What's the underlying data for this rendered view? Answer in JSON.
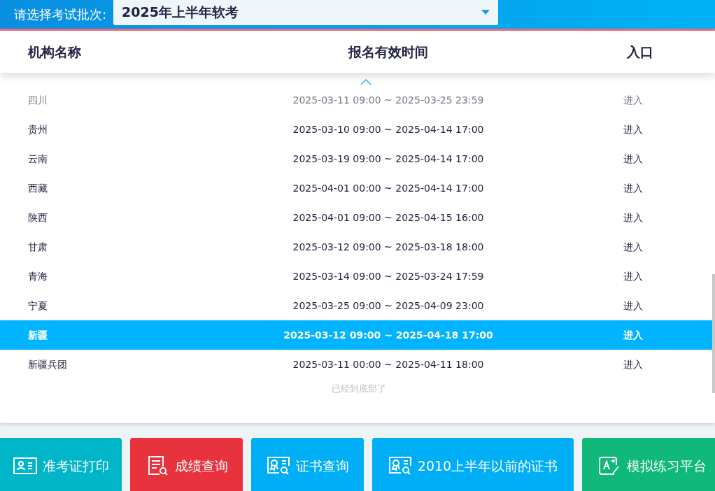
{
  "batch_select": {
    "label": "请选择考试批次:",
    "value": "2025年上半年软考"
  },
  "table": {
    "columns": [
      "机构名称",
      "报名有效时间",
      "入口"
    ],
    "rows": [
      {
        "name": "四川",
        "time": "2025-03-11 09:00 ~ 2025-03-25 23:59",
        "entry": "进入",
        "selected": false
      },
      {
        "name": "贵州",
        "time": "2025-03-10 09:00 ~ 2025-04-14 17:00",
        "entry": "进入",
        "selected": false
      },
      {
        "name": "云南",
        "time": "2025-03-19 09:00 ~ 2025-04-14 17:00",
        "entry": "进入",
        "selected": false
      },
      {
        "name": "西藏",
        "time": "2025-04-01 00:00 ~ 2025-04-14 17:00",
        "entry": "进入",
        "selected": false
      },
      {
        "name": "陕西",
        "time": "2025-04-01 09:00 ~ 2025-04-15 16:00",
        "entry": "进入",
        "selected": false
      },
      {
        "name": "甘肃",
        "time": "2025-03-12 09:00 ~ 2025-03-18 18:00",
        "entry": "进入",
        "selected": false
      },
      {
        "name": "青海",
        "time": "2025-03-14 09:00 ~ 2025-03-24 17:59",
        "entry": "进入",
        "selected": false
      },
      {
        "name": "宁夏",
        "time": "2025-03-25 09:00 ~ 2025-04-09 23:00",
        "entry": "进入",
        "selected": false
      },
      {
        "name": "新疆",
        "time": "2025-03-12 09:00 ~ 2025-04-18 17:00",
        "entry": "进入",
        "selected": true
      },
      {
        "name": "新疆兵团",
        "time": "2025-03-11 00:00 ~ 2025-04-11 18:00",
        "entry": "进入",
        "selected": false
      }
    ],
    "end_note": "已经到底部了"
  },
  "actions": [
    {
      "label": "准考证打印",
      "kind": "admit",
      "color": "#00b5c8"
    },
    {
      "label": "成绩查询",
      "kind": "score",
      "color": "#e8333f"
    },
    {
      "label": "证书查询",
      "kind": "cert",
      "color": "#00aef5"
    },
    {
      "label": "2010上半年以前的证书",
      "kind": "cert",
      "color": "#00aef5"
    },
    {
      "label": "模拟练习平台",
      "kind": "practice",
      "color": "#10b87c"
    }
  ]
}
